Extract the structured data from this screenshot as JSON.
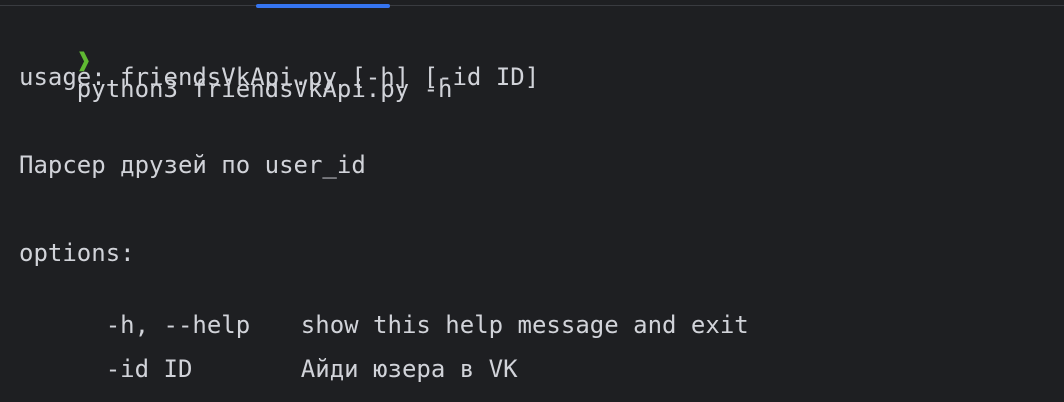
{
  "terminal": {
    "prompt_symbol": "❱",
    "command": "python3 friendsVkApi.py -h",
    "usage": "usage: friendsVkApi.py [-h] [-id ID]",
    "description": "Парсер друзей по user_id",
    "options_header": "options:",
    "options": [
      {
        "flag": "  -h, --help",
        "help": "show this help message and exit"
      },
      {
        "flag": "  -id ID",
        "help": "Айди юзера в VK"
      }
    ]
  },
  "colors": {
    "background": "#1e1f22",
    "text": "#d1d3d9",
    "prompt": "#5fb832",
    "tab_indicator": "#3574f0"
  }
}
